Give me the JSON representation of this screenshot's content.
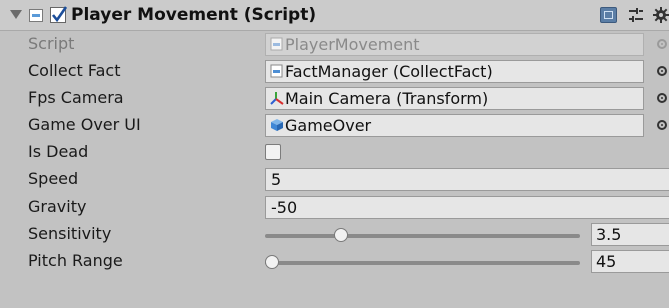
{
  "component": {
    "title": "Player Movement (Script)",
    "enabled": true,
    "icons": [
      "foldout-arrow-icon",
      "script-file-icon",
      "help-book-icon",
      "preset-icon",
      "gear-icon"
    ]
  },
  "fields": {
    "script": {
      "label": "Script",
      "value": "PlayerMovement",
      "icon": "script-file-icon"
    },
    "collect_fact": {
      "label": "Collect Fact",
      "value": "FactManager (CollectFact)",
      "icon": "script-file-icon"
    },
    "fps_camera": {
      "label": "Fps Camera",
      "value": "Main Camera (Transform)",
      "icon": "transform-icon"
    },
    "game_over_ui": {
      "label": "Game Over UI",
      "value": "GameOver",
      "icon": "gameobject-cube-icon"
    },
    "is_dead": {
      "label": "Is Dead",
      "checked": false
    },
    "speed": {
      "label": "Speed",
      "value": "5"
    },
    "gravity": {
      "label": "Gravity",
      "value": "-50"
    },
    "sensitivity": {
      "label": "Sensitivity",
      "value": "3.5",
      "fraction": 0.23
    },
    "pitch_range": {
      "label": "Pitch Range",
      "value": "45",
      "fraction": 0.0
    }
  },
  "colors": {
    "panel_bg": "#c2c2c2",
    "field_bg": "#e6e6e6",
    "checkbox_tick": "#1c4e9a",
    "help_icon": "#5b7ea6"
  }
}
